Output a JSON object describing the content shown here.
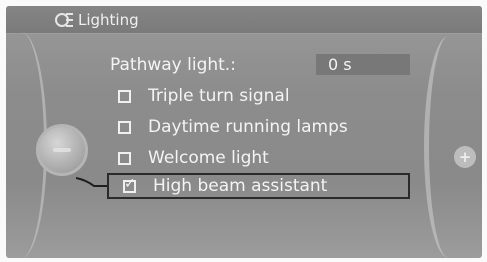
{
  "header": {
    "title": "Lighting",
    "icon": "lighting-settings-icon"
  },
  "menu": {
    "pathway_light": {
      "label": "Pathway light.:",
      "value": "0 s"
    },
    "items": [
      {
        "label": "Triple turn signal",
        "checked": false
      },
      {
        "label": "Daytime running lamps",
        "checked": false
      },
      {
        "label": "Welcome light",
        "checked": false
      },
      {
        "label": "High beam assistant",
        "checked": true,
        "selected": true
      }
    ]
  },
  "controls": {
    "plus_symbol": "+"
  },
  "colors": {
    "text": "#f4f4f4",
    "background": "#8c8c8c",
    "value_field": "#787878",
    "selection_border": "#2a2a2a"
  }
}
